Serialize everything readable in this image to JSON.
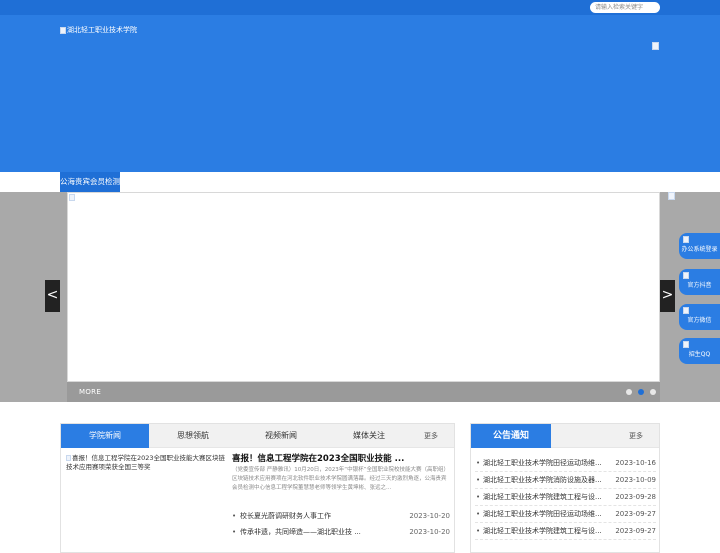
{
  "topbar": {
    "search_placeholder": "请输入检索关键字"
  },
  "header": {
    "logo_alt": "湖北轻工职业技术学院"
  },
  "nav": {
    "item": "公海贵宾会员检测"
  },
  "banner": {
    "more_label": "MORE",
    "slide_count": 3,
    "active_slide": 2,
    "prev_glyph": "<",
    "next_glyph": ">"
  },
  "side_buttons": [
    {
      "label": "办公系统登录"
    },
    {
      "label": "官方抖音"
    },
    {
      "label": "官方微信"
    },
    {
      "label": "招生QQ"
    }
  ],
  "news": {
    "tabs": [
      "学院新闻",
      "思想领航",
      "视频新闻",
      "媒体关注"
    ],
    "more_label": "更多",
    "featured_image_alt": "喜报！信息工程学院在2023全国职业技能大赛区块链技术应用赛项荣获全国三等奖",
    "featured_title": "喜报！信息工程学院在2023全国职业技能 ...",
    "featured_body": "（党委宣传部 严静雅讯）10月20日，2023年“中银杯”全国职业院校技能大赛（高职组）区块链技术应用赛项在河北软件职业技术学院圆满落幕。经过三天的激烈角逐，公海贵宾会员检测中心信息工程学院董慧慧老师等领学生黄坤彬、张远之...",
    "items": [
      {
        "title": "校长夏光蔚调研财务人事工作",
        "date": "2023-10-20"
      },
      {
        "title": "传承非遗，共同缔造——湖北职业技 ...",
        "date": "2023-10-20"
      }
    ]
  },
  "notice": {
    "title": "公告通知",
    "more_label": "更多",
    "items": [
      {
        "title": "湖北轻工职业技术学院田径运动场维...",
        "date": "2023-10-16"
      },
      {
        "title": "湖北轻工职业技术学院消防设施及器...",
        "date": "2023-10-09"
      },
      {
        "title": "湖北轻工职业技术学院建筑工程与设...",
        "date": "2023-09-28"
      },
      {
        "title": "湖北轻工职业技术学院田径运动场维...",
        "date": "2023-09-27"
      },
      {
        "title": "湖北轻工职业技术学院建筑工程与设...",
        "date": "2023-09-27"
      }
    ]
  },
  "colors": {
    "brand": "#2b7de3",
    "topbar": "#1f6fd6",
    "banner_bg": "#a9a9a9"
  }
}
